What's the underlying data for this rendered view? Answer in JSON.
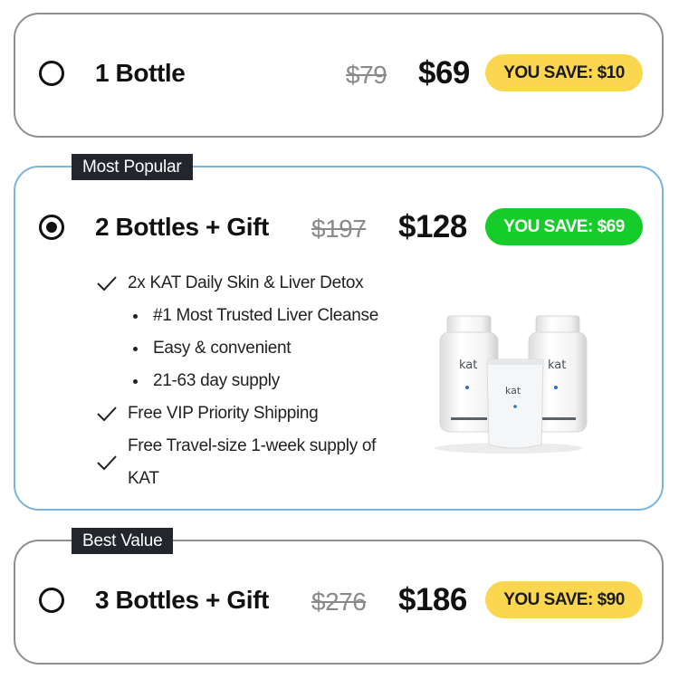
{
  "options": [
    {
      "name": "1 Bottle",
      "old_price": "$79",
      "price": "$69",
      "savings": "YOU SAVE: $10",
      "savings_color": "#fbd64f",
      "selected": false
    },
    {
      "tag": "Most Popular",
      "name": "2 Bottles + Gift",
      "old_price": "$197",
      "price": "$128",
      "savings": "YOU SAVE: $69",
      "savings_color": "#16cc2a",
      "selected": true,
      "features": [
        "2x KAT Daily Skin & Liver Detox",
        "#1 Most Trusted Liver Cleanse",
        "Easy & convenient",
        "21-63 day supply",
        "Free VIP Priority Shipping",
        "Free Travel-size 1-week supply of KAT"
      ],
      "product_label": "kat"
    },
    {
      "tag": "Best Value",
      "name": "3 Bottles + Gift",
      "old_price": "$276",
      "price": "$186",
      "savings": "YOU SAVE: $90",
      "savings_color": "#fbd64f",
      "selected": false
    }
  ],
  "colors": {
    "selected_border": "#79b4dd",
    "default_border": "#8f8f8f",
    "tag_background": "#23262d"
  },
  "icons": {
    "feature_marker": "check-icon",
    "sub_feature_marker": "bullet-icon",
    "radio_selected": "radio-checked-icon",
    "radio_unselected": "radio-empty-icon"
  }
}
